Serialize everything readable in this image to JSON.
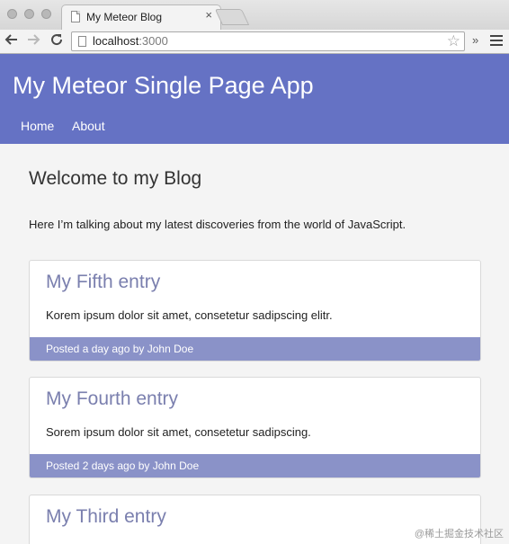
{
  "browser": {
    "tab_title": "My Meteor Blog",
    "tab_close": "×",
    "url_host": "localhost",
    "url_port": ":3000",
    "overflow_label": "»"
  },
  "app": {
    "title": "My Meteor Single Page App",
    "nav": [
      "Home",
      "About"
    ]
  },
  "main": {
    "heading": "Welcome to my Blog",
    "intro": "Here I’m talking about my latest discoveries from the world of JavaScript.",
    "posts": [
      {
        "title": "My Fifth entry",
        "body": "Korem ipsum dolor sit amet, consetetur sadipscing elitr.",
        "footer": "Posted a day ago by John Doe"
      },
      {
        "title": "My Fourth entry",
        "body": "Sorem ipsum dolor sit amet, consetetur sadipscing.",
        "footer": "Posted 2 days ago by John Doe"
      },
      {
        "title": "My Third entry"
      }
    ]
  },
  "watermark": "@稀土掘金技术社区",
  "colors": {
    "header_bg": "#6572c4",
    "post_footer_bg": "#8a92c8",
    "post_title": "#7a7fae",
    "page_bg": "#f4f4f4"
  },
  "icons": [
    "back-arrow-icon",
    "forward-arrow-icon",
    "reload-icon",
    "page-icon",
    "star-icon",
    "menu-icon"
  ]
}
